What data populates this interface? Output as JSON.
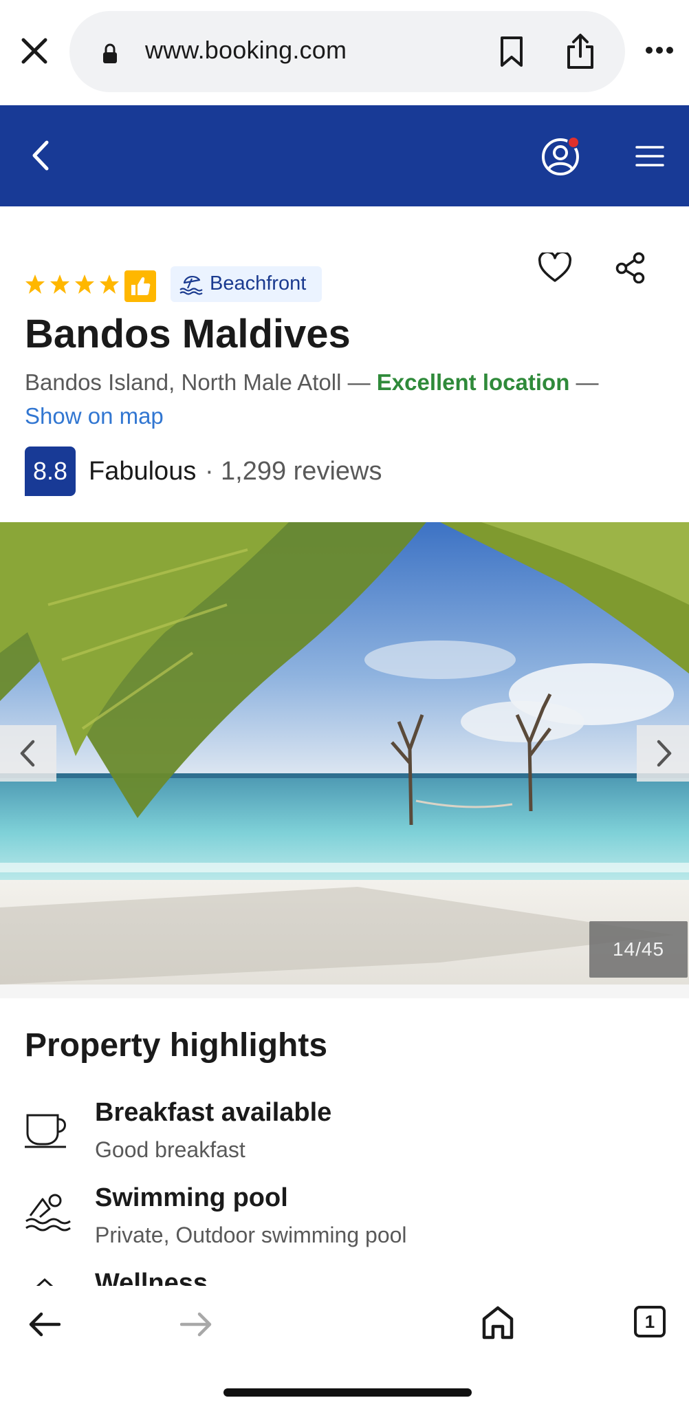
{
  "browser": {
    "url": "www.booking.com",
    "tab_count": "1"
  },
  "property": {
    "stars": 4,
    "tag": "Beachfront",
    "name": "Bandos Maldives",
    "address": "Bandos Island, North Male Atoll",
    "separator": " — ",
    "location_note": "Excellent location",
    "show_map": "Show on map",
    "score": "8.8",
    "rating_word": "Fabulous",
    "rating_separator": "·",
    "review_count": "1,299 reviews"
  },
  "gallery": {
    "counter": "14/45"
  },
  "highlights": {
    "title": "Property highlights",
    "items": [
      {
        "title": "Breakfast available",
        "subtitle": "Good breakfast",
        "icon": "coffee-cup-icon"
      },
      {
        "title": "Swimming pool",
        "subtitle": "Private, Outdoor swimming pool",
        "icon": "swimmer-icon"
      },
      {
        "title": "Wellness",
        "subtitle": "",
        "icon": "wellness-icon"
      }
    ]
  },
  "colors": {
    "brand_blue": "#183a96",
    "star_yellow": "#ffb700",
    "excellent_green": "#2f8a3a",
    "link_blue": "#3176d1"
  }
}
